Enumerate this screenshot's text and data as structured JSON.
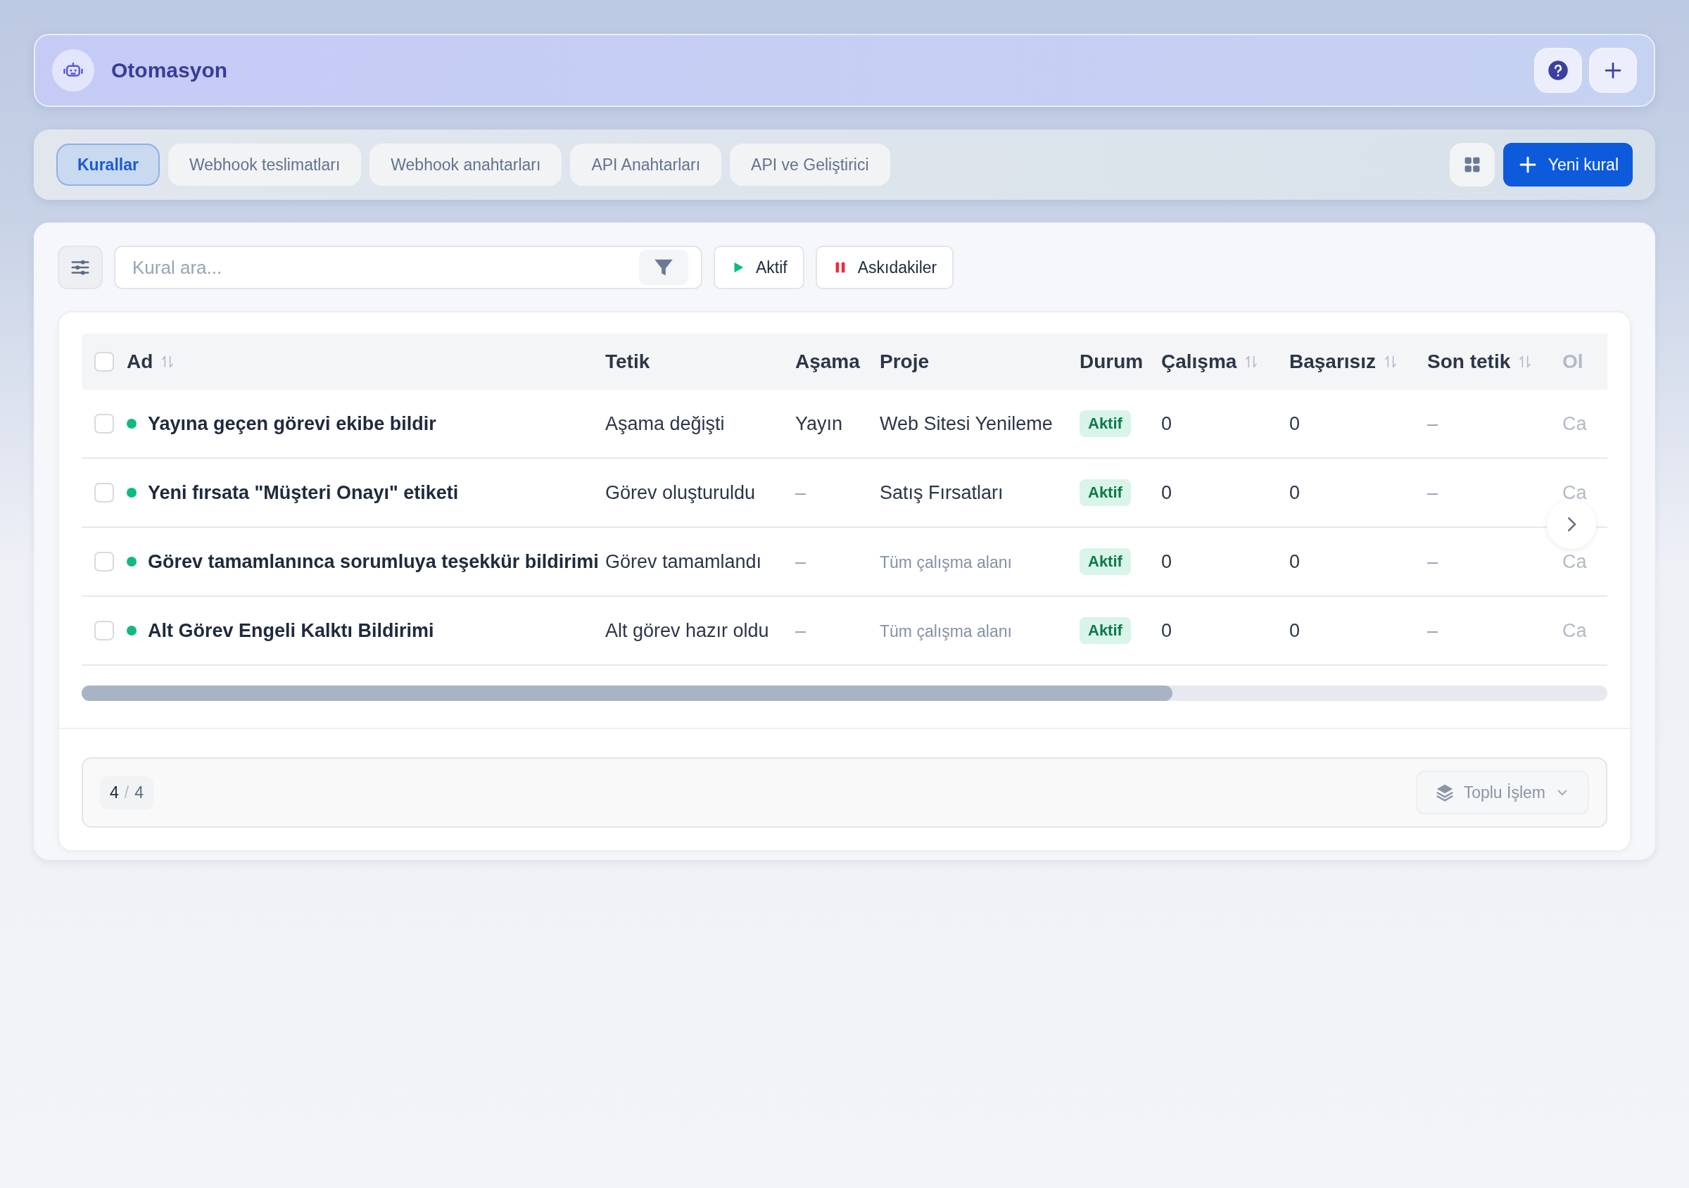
{
  "header": {
    "title": "Otomasyon"
  },
  "tabs": [
    {
      "label": "Kurallar",
      "selected": true
    },
    {
      "label": "Webhook teslimatları",
      "selected": false
    },
    {
      "label": "Webhook anahtarları",
      "selected": false
    },
    {
      "label": "API Anahtarları",
      "selected": false
    },
    {
      "label": "API ve Geliştirici",
      "selected": false
    }
  ],
  "new_button": "Yeni kural",
  "search": {
    "placeholder": "Kural ara..."
  },
  "filters": [
    {
      "label": "Aktif",
      "kind": "play"
    },
    {
      "label": "Askıdakiler",
      "kind": "pause"
    }
  ],
  "table": {
    "select_all_checked": false,
    "columns": [
      {
        "label": "Ad",
        "sortable": true
      },
      {
        "label": "Tetik",
        "sortable": false
      },
      {
        "label": "Aşama",
        "sortable": false
      },
      {
        "label": "Proje",
        "sortable": false
      },
      {
        "label": "Durum",
        "sortable": false
      },
      {
        "label": "Çalışma",
        "sortable": true
      },
      {
        "label": "Başarısız",
        "sortable": true
      },
      {
        "label": "Son tetik",
        "sortable": true
      },
      {
        "label": "Ol",
        "sortable": false
      }
    ],
    "rows": [
      {
        "checked": false,
        "name": "Yayına geçen görevi ekibe bildir",
        "trigger": "Aşama değişti",
        "stage": "Yayın",
        "project": "Web Sitesi Yenileme",
        "project_dimmed": false,
        "status": "Aktif",
        "runs": "0",
        "failed": "0",
        "last": "–",
        "column_9": "Ca"
      },
      {
        "checked": false,
        "name": "Yeni fırsata \"Müşteri Onayı\" etiketi",
        "trigger": "Görev oluşturuldu",
        "stage": "–",
        "project": "Satış Fırsatları",
        "project_dimmed": false,
        "status": "Aktif",
        "runs": "0",
        "failed": "0",
        "last": "–",
        "column_9": "Ca"
      },
      {
        "checked": false,
        "name": "Görev tamamlanınca sorumluya teşekkür bildirimi",
        "trigger": "Görev tamamlandı",
        "stage": "–",
        "project": "Tüm çalışma alanı",
        "project_dimmed": true,
        "status": "Aktif",
        "runs": "0",
        "failed": "0",
        "last": "–",
        "column_9": "Ca"
      },
      {
        "checked": false,
        "name": "Alt Görev Engeli Kalktı Bildirimi",
        "trigger": "Alt görev hazır oldu",
        "stage": "–",
        "project": "Tüm çalışma alanı",
        "project_dimmed": true,
        "status": "Aktif",
        "runs": "0",
        "failed": "0",
        "last": "–",
        "column_9": "Ca"
      }
    ]
  },
  "footer": {
    "count": "4",
    "separator": "/",
    "total": "4",
    "bulk_action": "Toplu İşlem"
  }
}
